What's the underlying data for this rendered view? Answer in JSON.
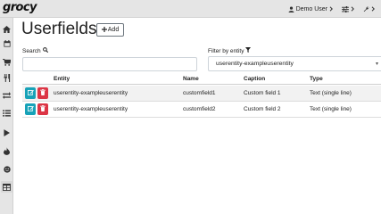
{
  "app": {
    "logo_text": "grocy"
  },
  "header": {
    "user_label": "Demo User",
    "user_icon": "user-icon",
    "menu_icon": "sliders-icon",
    "settings_icon": "wrench-icon"
  },
  "sidebar": {
    "items": [
      {
        "icon": "home-icon"
      },
      {
        "icon": "calendar-icon"
      },
      {
        "icon": "cart-icon"
      },
      {
        "icon": "utensils-icon"
      },
      {
        "icon": "exchange-icon"
      },
      {
        "icon": "list-icon"
      },
      {
        "icon": "play-icon"
      },
      {
        "icon": "fire-icon"
      },
      {
        "icon": "circle-icon"
      },
      {
        "icon": "table-icon"
      }
    ]
  },
  "page": {
    "title": "Userfields",
    "add_button_label": "Add"
  },
  "filters": {
    "search_label": "Search",
    "search_value": "",
    "entity_label": "Filter by entity",
    "entity_value": "userentity-exampleuserentity"
  },
  "table": {
    "headers": {
      "entity": "Entity",
      "name": "Name",
      "caption": "Caption",
      "type": "Type"
    },
    "rows": [
      {
        "entity": "userentity-exampleuserentity",
        "name": "customfield1",
        "caption": "Custom field 1",
        "type": "Text (single line)"
      },
      {
        "entity": "userentity-exampleuserentity",
        "name": "customfield2",
        "caption": "Custom field 2",
        "type": "Text (single line)"
      }
    ]
  },
  "colors": {
    "edit_button": "#17a2b8",
    "delete_button": "#dc3545",
    "chrome_background": "#e5e5e5"
  }
}
